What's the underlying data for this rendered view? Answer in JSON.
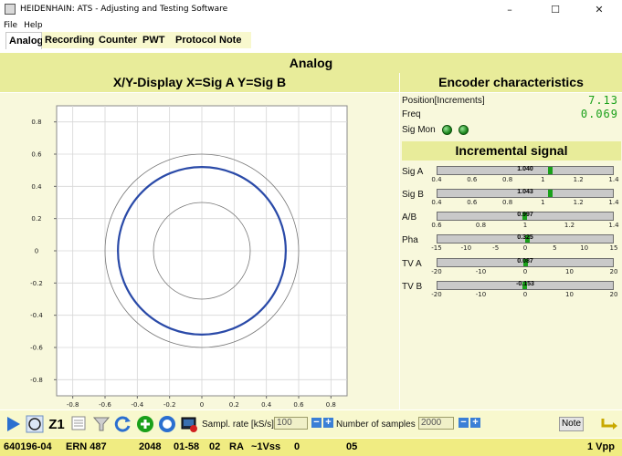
{
  "window": {
    "title": "HEIDENHAIN: ATS - Adjusting and Testing Software",
    "minimize": "–",
    "maximize": "☐",
    "close": "✕"
  },
  "menu": [
    "File",
    "Help"
  ],
  "tabs": [
    "Analog",
    "Recording",
    "Counter",
    "PWT",
    "Protocol",
    "Note"
  ],
  "active_tab": "Analog",
  "main_title": "Analog",
  "xy_display": {
    "title": "X/Y-Display X=Sig A Y=Sig B"
  },
  "encoder": {
    "title": "Encoder characteristics",
    "position_label": "Position[Increments]",
    "position_value": "7.13",
    "freq_label": "Freq",
    "freq_value": "0.069",
    "sigmon_label": "Sig Mon",
    "led_color": "#1f8a1f"
  },
  "incremental": {
    "title": "Incremental signal",
    "signals": [
      {
        "label": "Sig A",
        "value": "1.040",
        "level": 1.04,
        "scale": [
          "0.4",
          "0.6",
          "0.8",
          "1",
          "1.2",
          "1.4"
        ],
        "min": 0.4,
        "max": 1.4
      },
      {
        "label": "Sig B",
        "value": "1.043",
        "level": 1.043,
        "scale": [
          "0.4",
          "0.6",
          "0.8",
          "1",
          "1.2",
          "1.4"
        ],
        "min": 0.4,
        "max": 1.4
      },
      {
        "label": "A/B",
        "value": "0.997",
        "level": 0.997,
        "scale": [
          "0.6",
          "0.8",
          "1",
          "1.2",
          "1.4"
        ],
        "min": 0.6,
        "max": 1.4
      },
      {
        "label": "Pha",
        "value": "0.325",
        "level": 0.325,
        "scale": [
          "-15",
          "-10",
          "-5",
          "0",
          "5",
          "10",
          "15"
        ],
        "min": -15,
        "max": 15
      },
      {
        "label": "TV A",
        "value": "0.087",
        "level": 0.087,
        "scale": [
          "-20",
          "-10",
          "0",
          "10",
          "20"
        ],
        "min": -20,
        "max": 20
      },
      {
        "label": "TV B",
        "value": "-0.153",
        "level": -0.153,
        "scale": [
          "-20",
          "-10",
          "0",
          "10",
          "20"
        ],
        "min": -20,
        "max": 20
      }
    ]
  },
  "chart_data": {
    "type": "scatter",
    "title": "",
    "xlabel": "",
    "ylabel": "",
    "xlim": [
      -0.9,
      0.9
    ],
    "ylim": [
      -0.9,
      0.9
    ],
    "x_ticks": [
      "-0.8",
      "-0.6",
      "-0.4",
      "-0.2",
      "0",
      "0.2",
      "0.4",
      "0.6",
      "0.8"
    ],
    "y_ticks": [
      "0.8",
      "0.6",
      "0.4",
      "0.2",
      "0",
      "-0.2",
      "-0.4",
      "-0.6",
      "-0.8"
    ],
    "grid": true,
    "reference_circles": [
      0.3,
      0.6
    ],
    "series": [
      {
        "shape": "circle",
        "center": [
          0,
          0
        ],
        "radius": 0.52,
        "color": "#2a4aa8"
      }
    ]
  },
  "toolbar": {
    "z1_label": "Z1",
    "sample_rate_label": "Sampl. rate [kS/s]",
    "sample_rate_value": "100",
    "samples_label": "Number of samples",
    "samples_value": "2000",
    "note_label": "Note",
    "minus": "−",
    "plus": "+"
  },
  "status": {
    "id": "640196-04",
    "model": "ERN 487",
    "lines": "2048",
    "code1": "01-58",
    "code2": "02",
    "code3": "RA",
    "signal": "~1Vss",
    "code4": "0",
    "code5": "05",
    "level": "1 Vpp"
  }
}
